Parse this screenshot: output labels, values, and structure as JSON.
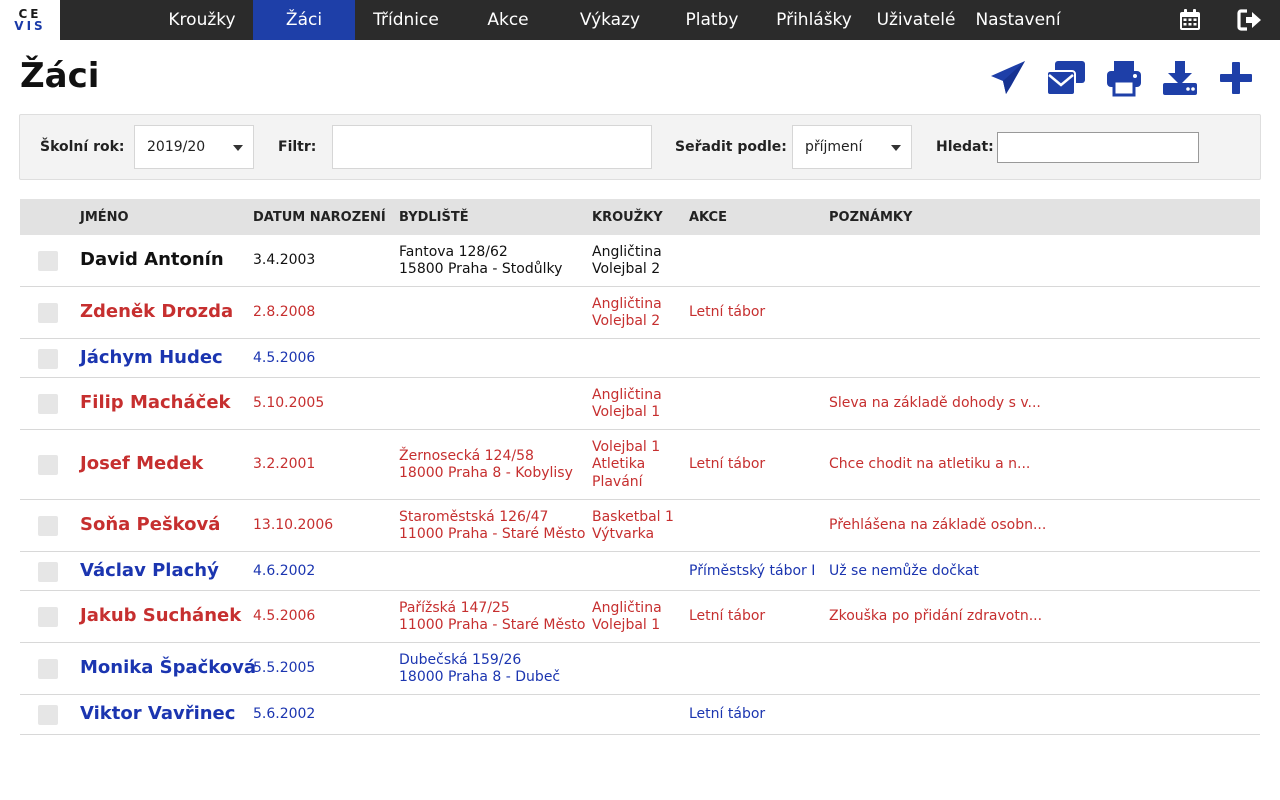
{
  "app": {
    "logo_line1": "CE",
    "logo_line2": "VIS"
  },
  "nav": {
    "items": [
      {
        "label": "Kroužky",
        "active": false
      },
      {
        "label": "Žáci",
        "active": true
      },
      {
        "label": "Třídnice",
        "active": false
      },
      {
        "label": "Akce",
        "active": false
      },
      {
        "label": "Výkazy",
        "active": false
      },
      {
        "label": "Platby",
        "active": false
      },
      {
        "label": "Přihlášky",
        "active": false
      },
      {
        "label": "Uživatelé",
        "active": false
      },
      {
        "label": "Nastavení",
        "active": false
      }
    ],
    "icons": [
      "calendar-icon",
      "logout-icon"
    ]
  },
  "page": {
    "title": "Žáci",
    "tools": [
      "send-icon",
      "mail-icon",
      "print-icon",
      "download-icon",
      "add-icon"
    ]
  },
  "filters": {
    "year_label": "Školní rok:",
    "year_value": "2019/20",
    "filter_label": "Filtr:",
    "filter_value": "",
    "sort_label": "Seřadit podle:",
    "sort_value": "příjmení",
    "search_label": "Hledat:",
    "search_value": ""
  },
  "table": {
    "headers": [
      "JMÉNO",
      "DATUM NAROZENÍ",
      "BYDLIŠTĚ",
      "KROUŽKY",
      "AKCE",
      "POZNÁMKY"
    ],
    "colors": {
      "black": "#111111",
      "red": "#c62f2f",
      "blue": "#1b35b0"
    },
    "rows": [
      {
        "name": "David Antonín",
        "color": "black",
        "birth": "3.4.2003",
        "address": [
          "Fantova 128/62",
          "15800 Praha - Stodůlky"
        ],
        "clubs": [
          "Angličtina",
          "Volejbal 2"
        ],
        "events": "",
        "note": ""
      },
      {
        "name": "Zdeněk Drozda",
        "color": "red",
        "birth": "2.8.2008",
        "address": [],
        "clubs": [
          "Angličtina",
          "Volejbal 2"
        ],
        "events": "Letní tábor",
        "note": ""
      },
      {
        "name": "Jáchym Hudec",
        "color": "blue",
        "birth": "4.5.2006",
        "address": [],
        "clubs": [],
        "events": "",
        "note": ""
      },
      {
        "name": "Filip Macháček",
        "color": "red",
        "birth": "5.10.2005",
        "address": [],
        "clubs": [
          "Angličtina",
          "Volejbal 1"
        ],
        "events": "",
        "note": "Sleva na základě dohody s v..."
      },
      {
        "name": "Josef Medek",
        "color": "red",
        "birth": "3.2.2001",
        "address": [
          "Žernosecká 124/58",
          "18000 Praha 8 - Kobylisy"
        ],
        "clubs": [
          "Volejbal 1",
          "Atletika",
          "Plavání"
        ],
        "events": "Letní tábor",
        "note": "Chce chodit na atletiku a n..."
      },
      {
        "name": "Soňa Pešková",
        "color": "red",
        "birth": "13.10.2006",
        "address": [
          "Staroměstská 126/47",
          "11000 Praha - Staré Město"
        ],
        "clubs": [
          "Basketbal 1",
          "Výtvarka"
        ],
        "events": "",
        "note": "Přehlášena na základě osobn..."
      },
      {
        "name": "Václav Plachý",
        "color": "blue",
        "birth": "4.6.2002",
        "address": [],
        "clubs": [],
        "events": "Příměstský tábor I",
        "note": "Už se nemůže dočkat"
      },
      {
        "name": "Jakub Suchánek",
        "color": "red",
        "birth": "4.5.2006",
        "address": [
          "Pařížská 147/25",
          "11000 Praha - Staré Město"
        ],
        "clubs": [
          "Angličtina",
          "Volejbal 1"
        ],
        "events": "Letní tábor",
        "note": "Zkouška po přidání zdravotn..."
      },
      {
        "name": "Monika Špačková",
        "color": "blue",
        "birth": "5.5.2005",
        "address": [
          "Dubečská 159/26",
          "18000 Praha 8 - Dubeč"
        ],
        "clubs": [],
        "events": "",
        "note": ""
      },
      {
        "name": "Viktor Vavřinec",
        "color": "blue",
        "birth": "5.6.2002",
        "address": [],
        "clubs": [],
        "events": "Letní tábor",
        "note": ""
      }
    ]
  }
}
